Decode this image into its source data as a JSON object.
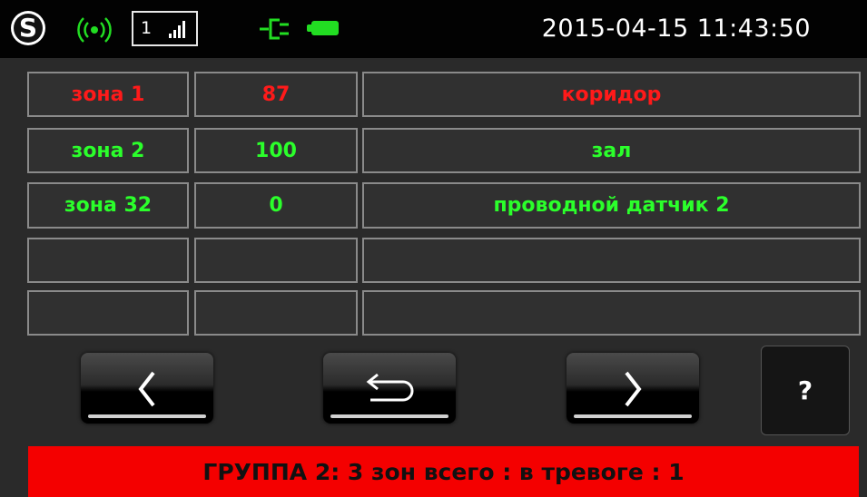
{
  "status_bar": {
    "logo_letter": "S",
    "signal_label": "1",
    "datetime": "2015-04-15 11:43:50",
    "icons": [
      "radio-signal-icon",
      "cellular-signal-icon",
      "power-plug-icon",
      "battery-icon"
    ],
    "accent_color": "#22dd22"
  },
  "zones": [
    {
      "zone": "зона 1",
      "value": "87",
      "name": "коридор",
      "state": "alarm"
    },
    {
      "zone": "зона 2",
      "value": "100",
      "name": "зал",
      "state": "ok"
    },
    {
      "zone": "зона 32",
      "value": "0",
      "name": "проводной датчик 2",
      "state": "ok"
    },
    {
      "zone": "",
      "value": "",
      "name": "",
      "state": "empty"
    },
    {
      "zone": "",
      "value": "",
      "name": "",
      "state": "empty"
    }
  ],
  "colors": {
    "alarm": "#ff1a1a",
    "ok": "#2bff2b",
    "footer_bg": "#f40000"
  },
  "nav": {
    "prev_icon": "chevron-left-icon",
    "back_icon": "return-arrow-icon",
    "next_icon": "chevron-right-icon",
    "help_label": "?"
  },
  "footer": {
    "text": "ГРУППА 2: 3 зон всего :  в тревоге : 1"
  }
}
